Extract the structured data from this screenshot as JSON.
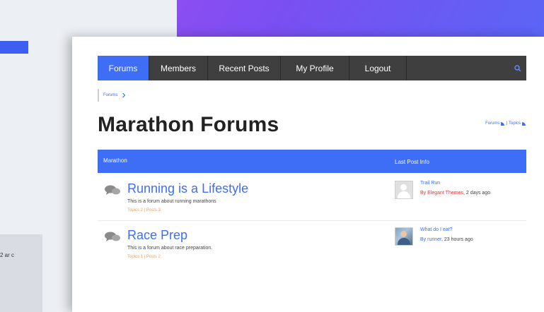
{
  "background_caption": "2 ar c",
  "nav": {
    "items": [
      {
        "label": "Forums",
        "active": true
      },
      {
        "label": "Members",
        "active": false
      },
      {
        "label": "Recent Posts",
        "active": false
      },
      {
        "label": "My Profile",
        "active": false
      },
      {
        "label": "Logout",
        "active": false
      }
    ],
    "search_icon": "search-icon"
  },
  "breadcrumb": {
    "item": "Forums"
  },
  "page_title": "Marathon Forums",
  "feeds": {
    "forums": "Forums",
    "separator": "|",
    "topics": "Topics"
  },
  "table": {
    "col_forum": "Marathon",
    "col_last": "Last Post Info",
    "rows": [
      {
        "title": "Running is a Lifestyle",
        "description": "This is a forum about running marathons",
        "counts": "Topics 2 | Posts 3",
        "last_post_title": "Trail Run",
        "last_post_by": "By Elegant Themes",
        "last_post_time": ", 2 days ago"
      },
      {
        "title": "Race Prep",
        "description": "This is a forum about race preparation.",
        "counts": "Topics 1 | Posts 2",
        "last_post_title": "What do I eat?",
        "last_post_by": "By runner",
        "last_post_time": ", 23 hours ago"
      }
    ]
  },
  "colors": {
    "accent": "#3d6ef5",
    "nav_bg": "#3f3f3f",
    "counts": "#f29b62",
    "author_red": "#e0393e"
  }
}
